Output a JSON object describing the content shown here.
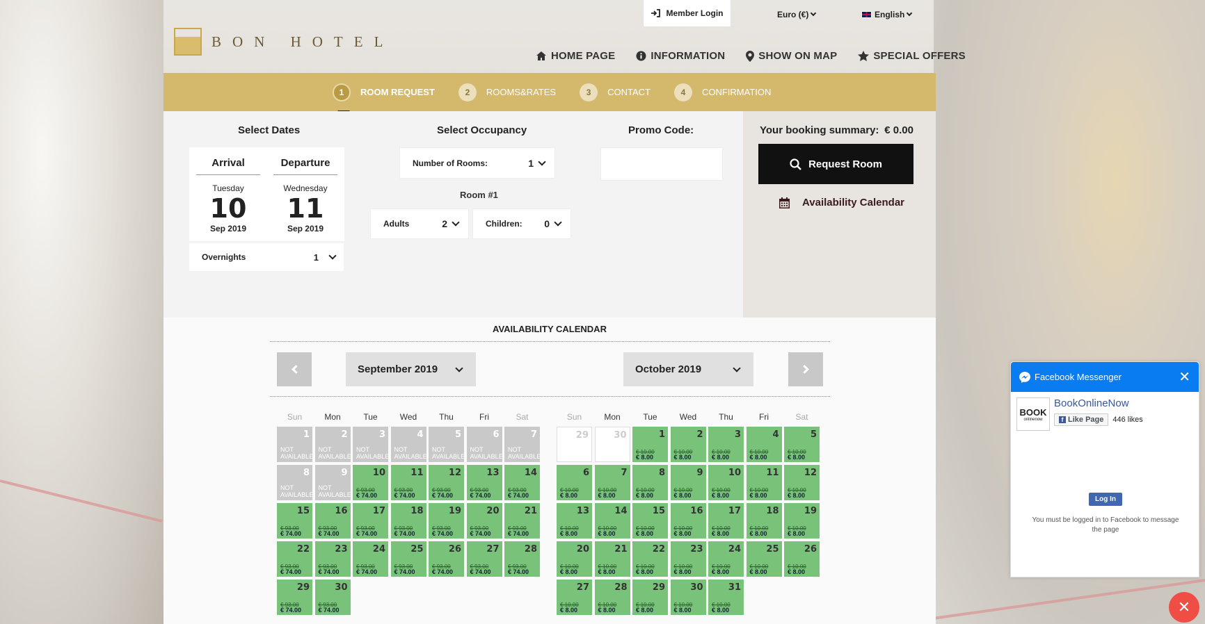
{
  "header": {
    "member_login": "Member Login",
    "currency": "Euro (€)",
    "language": "English",
    "logo_text": "BON HOTEL",
    "nav": [
      {
        "label": "HOME PAGE",
        "icon": "home-icon"
      },
      {
        "label": "INFORMATION",
        "icon": "info-icon"
      },
      {
        "label": "SHOW ON MAP",
        "icon": "map-pin-icon"
      },
      {
        "label": "SPECIAL OFFERS",
        "icon": "star-icon"
      }
    ]
  },
  "steps": [
    {
      "num": "1",
      "label": "ROOM REQUEST",
      "active": true
    },
    {
      "num": "2",
      "label": "ROOMS&RATES",
      "active": false
    },
    {
      "num": "3",
      "label": "CONTACT",
      "active": false
    },
    {
      "num": "4",
      "label": "CONFIRMATION",
      "active": false
    }
  ],
  "dates": {
    "title": "Select Dates",
    "arrival": {
      "label": "Arrival",
      "weekday": "Tuesday",
      "day": "10",
      "month_year": "Sep 2019"
    },
    "departure": {
      "label": "Departure",
      "weekday": "Wednesday",
      "day": "11",
      "month_year": "Sep 2019"
    },
    "overnights_label": "Overnights",
    "overnights_value": "1"
  },
  "occupancy": {
    "title": "Select Occupancy",
    "rooms_label": "Number of Rooms:",
    "rooms_value": "1",
    "room_label": "Room #1",
    "adults_label": "Adults",
    "adults_value": "2",
    "children_label": "Children:",
    "children_value": "0"
  },
  "promo": {
    "title": "Promo Code:",
    "value": ""
  },
  "summary": {
    "title": "Your booking summary:",
    "total": "€ 0.00",
    "request_button": "Request Room",
    "availability_link": "Availability Calendar"
  },
  "calendar": {
    "title": "AVAILABILITY CALENDAR",
    "left_month": "September 2019",
    "right_month": "October 2019",
    "weekdays": [
      "Sun",
      "Mon",
      "Tue",
      "Wed",
      "Thu",
      "Fri",
      "Sat"
    ],
    "not_available_text": "NOT AVAILABLE",
    "september": {
      "offset": 0,
      "not_available": [
        1,
        2,
        3,
        4,
        5,
        6,
        7,
        8,
        9
      ],
      "days": 30,
      "old_price": "€ 93.00",
      "price": "€ 74.00"
    },
    "october": {
      "past_days": [
        "29",
        "30"
      ],
      "offset": 2,
      "days": 31,
      "old_price": "€ 10.00",
      "price": "€ 8.00"
    }
  },
  "messenger": {
    "title": "Facebook Messenger",
    "page_name": "BookOnlineNow",
    "logo_text": "BOOK",
    "logo_sub": "onlinenow",
    "like_button": "Like Page",
    "likes": "446 likes",
    "login_button": "Log In",
    "message": "You must be logged in to Facebook to message the page"
  }
}
